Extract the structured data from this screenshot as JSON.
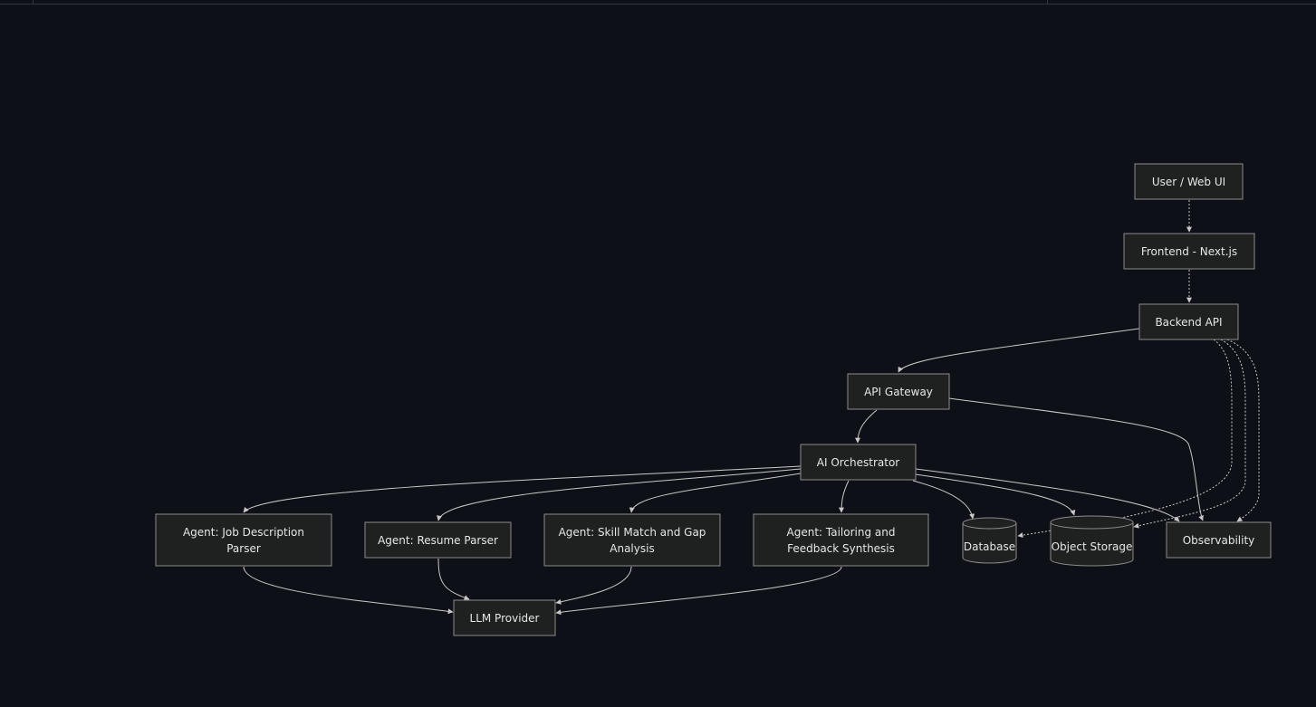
{
  "diagram": {
    "nodes": {
      "user": "User / Web UI",
      "frontend": "Frontend - Next.js",
      "backend": "Backend API",
      "gateway": "API Gateway",
      "orchestrator": "AI Orchestrator",
      "agent_jd": [
        "Agent: Job Description",
        "Parser"
      ],
      "agent_resume": "Agent: Resume Parser",
      "agent_skill": [
        "Agent: Skill Match and Gap",
        "Analysis"
      ],
      "agent_tailor": [
        "Agent: Tailoring and",
        "Feedback Synthesis"
      ],
      "database": "Database",
      "storage": "Object Storage",
      "observability": "Observability",
      "llm": "LLM Provider"
    }
  }
}
